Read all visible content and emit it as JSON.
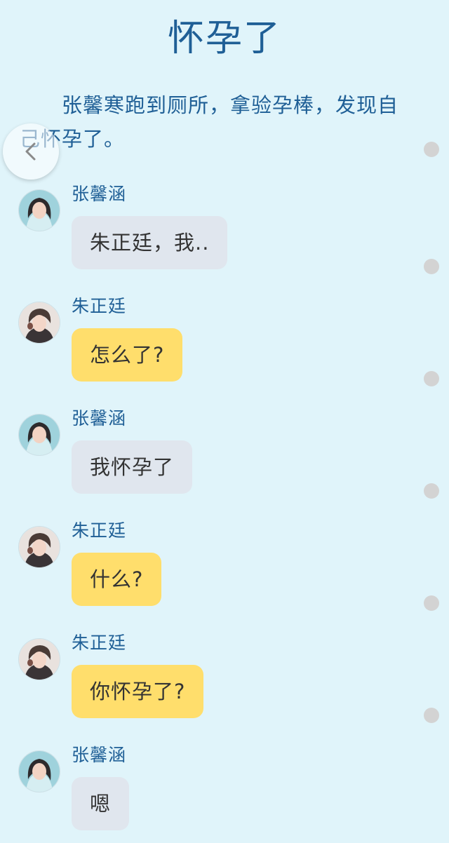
{
  "chapter": {
    "title": "怀孕了",
    "narration": "张馨寒跑到厕所，拿验孕棒，发现自己怀孕了。"
  },
  "controls": {
    "back_icon": "chevron-left-icon"
  },
  "colors": {
    "background": "#e0f4fa",
    "title_blue": "#1f5f96",
    "bubble_gray": "#e0e6ee",
    "bubble_yellow": "#ffde6c",
    "scroll_dot": "#d3d3d3"
  },
  "messages": [
    {
      "sender": "张馨涵",
      "text": "朱正廷，我..",
      "style": "gray"
    },
    {
      "sender": "朱正廷",
      "text": "怎么了?",
      "style": "yellow"
    },
    {
      "sender": "张馨涵",
      "text": "我怀孕了",
      "style": "gray"
    },
    {
      "sender": "朱正廷",
      "text": "什么?",
      "style": "yellow"
    },
    {
      "sender": "朱正廷",
      "text": "你怀孕了?",
      "style": "yellow"
    },
    {
      "sender": "张馨涵",
      "text": "嗯",
      "style": "gray"
    }
  ]
}
